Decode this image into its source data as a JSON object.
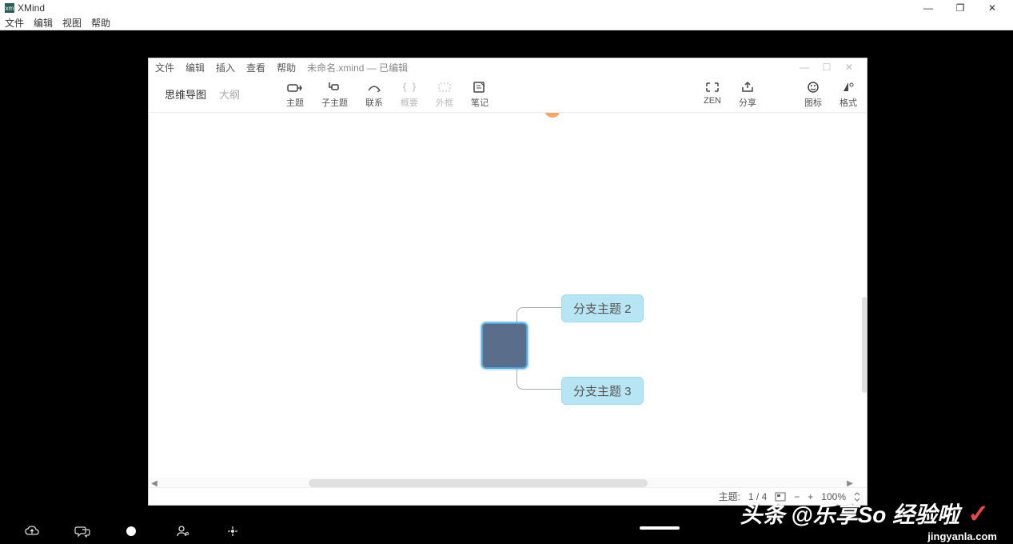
{
  "outer_window": {
    "title": "XMind",
    "logo_text": "xm",
    "menu": [
      "文件",
      "编辑",
      "视图",
      "帮助"
    ],
    "controls": {
      "minimize": "—",
      "maximize": "❐",
      "close": "✕"
    }
  },
  "inner_window": {
    "menu": [
      "文件",
      "编辑",
      "插入",
      "查看",
      "帮助"
    ],
    "document_name": "未命名.xmind — 已编辑",
    "controls": {
      "minimize": "—",
      "maximize": "☐",
      "close": "✕"
    }
  },
  "view_tabs": {
    "mindmap": "思维导图",
    "outline": "大纲"
  },
  "toolbar": {
    "topic": "主题",
    "subtopic": "子主题",
    "relationship": "联系",
    "summary": "概要",
    "boundary": "外框",
    "notes": "笔记",
    "zen": "ZEN",
    "share": "分享",
    "markers": "图标",
    "format": "格式"
  },
  "mindmap": {
    "central_topic": "",
    "branches": {
      "b2": "分支主题 2",
      "b3": "分支主题 3"
    }
  },
  "statusbar": {
    "topic_label": "主题:",
    "topic_count": "1 / 4",
    "zoom_out": "−",
    "zoom_in": "+",
    "zoom_level": "100%",
    "fit_icon": "⤢"
  },
  "watermark": {
    "text": "头条 @乐享So 经验啦",
    "check": "✓",
    "url": "jingyanla.com"
  }
}
